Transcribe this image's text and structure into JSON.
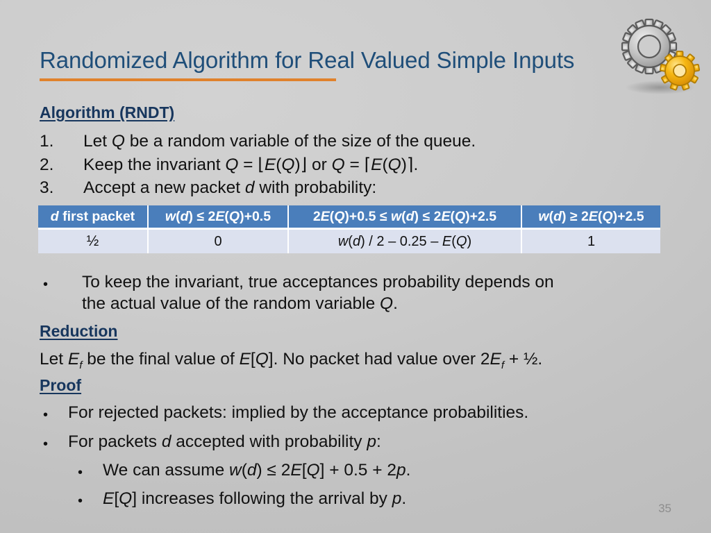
{
  "slide": {
    "title": "Randomized Algorithm for Real Valued Simple Inputs",
    "number": "35",
    "accent_orange": "#e0822c",
    "title_blue": "#1f4e79",
    "table_header_blue": "#4a7ebb",
    "table_row_lavender": "#dce1ef",
    "background_gray": "#c9c9c9"
  },
  "algorithm": {
    "heading": "Algorithm (RNDT)",
    "steps": [
      {
        "number": "1.",
        "text_html": "Let <i class=\"m\">Q</i> be a random variable of the size of the queue."
      },
      {
        "number": "2.",
        "text_html": "Keep the invariant <i class=\"m\">Q</i> = <span class=\"brk\">⌊</span><i class=\"m\">E</i>(<i class=\"m\">Q</i>)<span class=\"brk\">⌋</span> or <i class=\"m\">Q</i> = <span class=\"brk\">⌈</span><i class=\"m\">E</i>(<i class=\"m\">Q</i>)<span class=\"brk\">⌉</span>."
      },
      {
        "number": "3.",
        "text_html": "Accept a new packet <i class=\"m\">d</i> with probability:"
      }
    ]
  },
  "table": {
    "headers_html": [
      "<i class=\"m\">d</i> first packet",
      "<i class=\"m\">w</i>(<i class=\"m\">d</i>) ≤ 2<i class=\"m\">E</i>(<i class=\"m\">Q</i>)+0.5",
      "2<i class=\"m\">E</i>(<i class=\"m\">Q</i>)+0.5 ≤ <i class=\"m\">w</i>(<i class=\"m\">d</i>) ≤ 2<i class=\"m\">E</i>(<i class=\"m\">Q</i>)+2.5",
      "<i class=\"m\">w</i>(<i class=\"m\">d</i>) ≥ 2<i class=\"m\">E</i>(<i class=\"m\">Q</i>)+2.5"
    ],
    "headers_plain": [
      "d first packet",
      "w(d) ≤ 2E(Q)+0.5",
      "2E(Q)+0.5 ≤ w(d) ≤ 2E(Q)+2.5",
      "w(d) ≥ 2E(Q)+2.5"
    ],
    "row_html": [
      "<span class=\"frac\">½</span>",
      "0",
      "<i class=\"m\">w</i>(<i class=\"m\">d</i>) / 2 – 0.25 – <i class=\"m\">E</i>(<i class=\"m\">Q</i>)",
      "1"
    ],
    "row_plain": [
      "½",
      "0",
      "w(d) / 2 – 0.25 – E(Q)",
      "1"
    ]
  },
  "invariant_note": {
    "bullet": "•",
    "line1_html": "To keep the invariant, true acceptances probability depends on",
    "line2_html": "the actual value of the random variable <i class=\"m\">Q</i>."
  },
  "reduction": {
    "heading": "Reduction",
    "text_html": "Let <i class=\"m\">E<sub>f</sub></i> be the final value of <i class=\"m\">E</i>[<i class=\"m\">Q</i>]. No packet had value over 2<i class=\"m\">E<sub>f</sub></i> + ½."
  },
  "proof": {
    "heading": "Proof",
    "bullet": "•",
    "items_html": [
      "For rejected packets: implied by the acceptance probabilities.",
      "For packets <i class=\"m\">d</i> accepted with probability <i class=\"m\">p</i>:"
    ],
    "subitems_html": [
      "We can assume <i class=\"m\">w</i>(<i class=\"m\">d</i>) ≤ 2<i class=\"m\">E</i>[<i class=\"m\">Q</i>] + 0.5 + 2<i class=\"m\">p</i>.",
      "<i class=\"m\">E</i>[<i class=\"m\">Q</i>] increases following the arrival by <i class=\"m\">p</i>."
    ]
  },
  "decoration": {
    "gears_icon": "two-gears-icon",
    "large_gear_color": "#b8b8b8",
    "small_gear_color": "#f0a80c"
  }
}
